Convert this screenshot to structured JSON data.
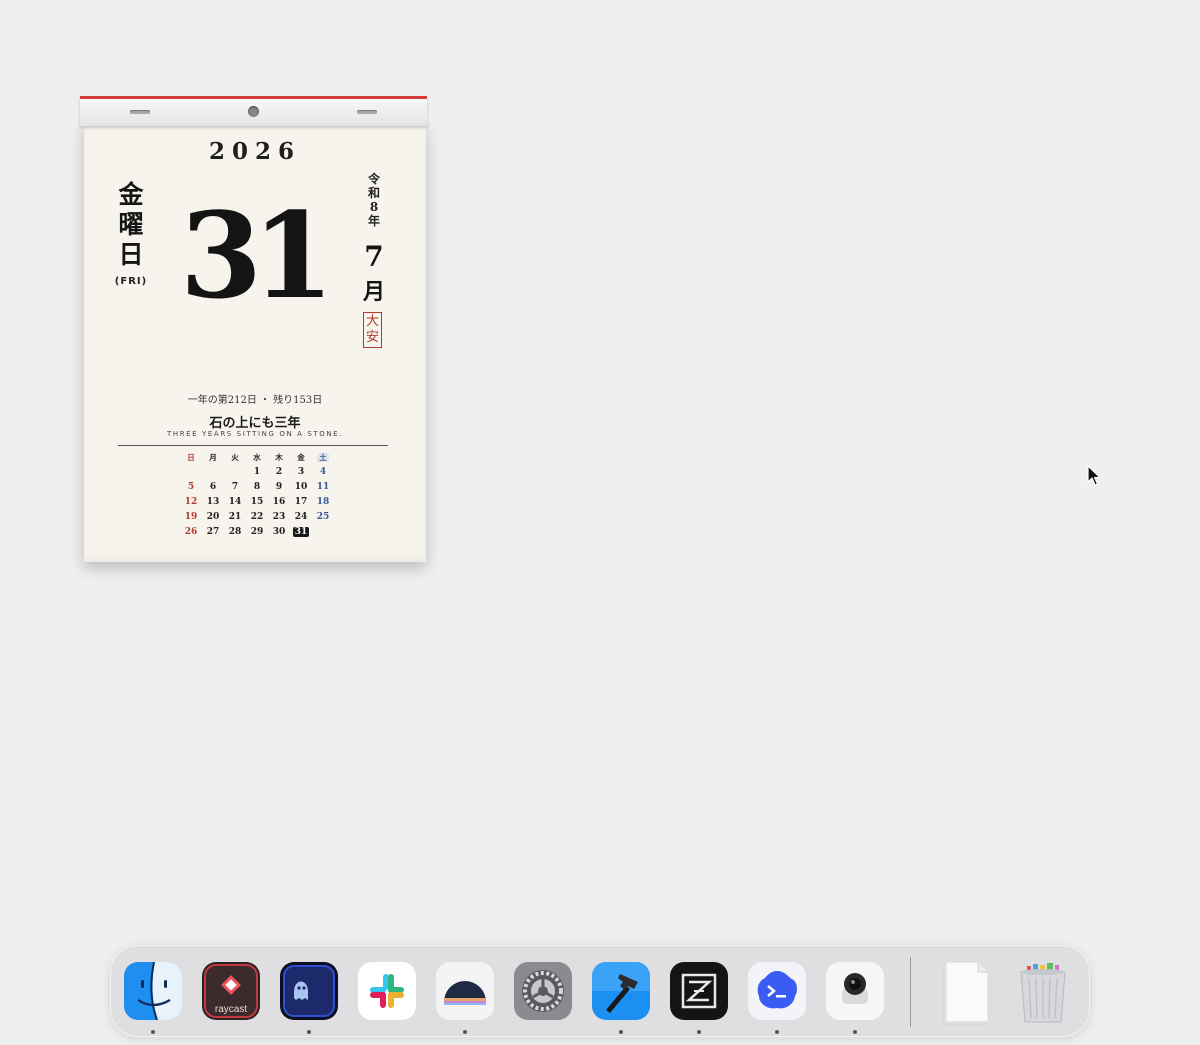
{
  "calendar": {
    "year": "2026",
    "weekday_kanji": [
      "金",
      "曜",
      "日"
    ],
    "weekday_en": "(FRI)",
    "day": "31",
    "era_chars": [
      "令",
      "和",
      "8",
      "年"
    ],
    "month_num": "7",
    "month_kanji": "月",
    "rokuyo_chars": [
      "大",
      "安"
    ],
    "day_info": "一年の第212日 ・ 残り153日",
    "proverb": "石の上にも三年",
    "proverb_en": "THREE YEARS SITTING ON A STONE.",
    "mini_headers": [
      "日",
      "月",
      "火",
      "水",
      "木",
      "金",
      "土"
    ],
    "mini_weeks": [
      [
        "",
        "",
        "",
        "1",
        "2",
        "3",
        "4"
      ],
      [
        "5",
        "6",
        "7",
        "8",
        "9",
        "10",
        "11"
      ],
      [
        "12",
        "13",
        "14",
        "15",
        "16",
        "17",
        "18"
      ],
      [
        "19",
        "20",
        "21",
        "22",
        "23",
        "24",
        "25"
      ],
      [
        "26",
        "27",
        "28",
        "29",
        "30",
        "31",
        ""
      ]
    ],
    "today": "31",
    "colors": {
      "accent_red": "#d63a32",
      "sunday": "#b33a2e",
      "saturday": "#3a5a9a"
    }
  },
  "dock": {
    "apps": [
      {
        "name": "finder-icon",
        "running": true
      },
      {
        "name": "raycast-icon",
        "label": "raycast",
        "running": false
      },
      {
        "name": "ghost-terminal-icon",
        "running": true
      },
      {
        "name": "slack-icon",
        "running": false
      },
      {
        "name": "horizon-app-icon",
        "running": true
      },
      {
        "name": "system-settings-icon",
        "running": false
      },
      {
        "name": "xcode-hammer-icon",
        "running": true
      },
      {
        "name": "zed-editor-icon",
        "running": true
      },
      {
        "name": "warp-terminal-icon",
        "running": true
      },
      {
        "name": "camera-app-icon",
        "running": true
      }
    ],
    "extras": [
      {
        "name": "document-stack-icon"
      },
      {
        "name": "trash-icon"
      }
    ]
  }
}
